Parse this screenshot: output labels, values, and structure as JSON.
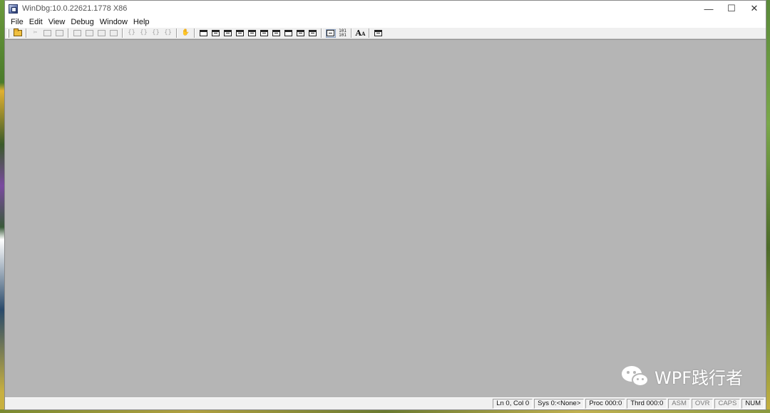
{
  "window": {
    "title": "WinDbg:10.0.22621.1778 X86"
  },
  "window_controls": {
    "minimize": "—",
    "maximize": "☐",
    "close": "✕"
  },
  "menu": [
    "File",
    "Edit",
    "View",
    "Debug",
    "Window",
    "Help"
  ],
  "toolbar": {
    "tools": [
      "open-folder",
      "cut",
      "copy",
      "paste",
      "go",
      "restart",
      "stop-debugging",
      "detach",
      "step-into",
      "step-over",
      "step-out",
      "run-to-cursor",
      "break",
      "command-window",
      "watch-window",
      "locals-window",
      "registers-window",
      "memory-window",
      "call-stack-window",
      "disassembly-window",
      "scratch-pad",
      "processes-threads",
      "source-mode",
      "hex-mode",
      "font",
      "options"
    ],
    "hex_label": "101 101",
    "font_label": "A",
    "font_label_small": "A"
  },
  "status": {
    "ln_col": "Ln 0, Col 0",
    "sys": "Sys 0:<None>",
    "proc": "Proc 000:0",
    "thrd": "Thrd 000:0",
    "asm": "ASM",
    "ovr": "OVR",
    "caps": "CAPS",
    "num": "NUM"
  },
  "watermark": {
    "text": "WPF践行者"
  },
  "colors": {
    "client_bg": "#b5b5b5",
    "chrome_bg": "#f0f0f0",
    "titlebar_bg": "#ffffff"
  }
}
